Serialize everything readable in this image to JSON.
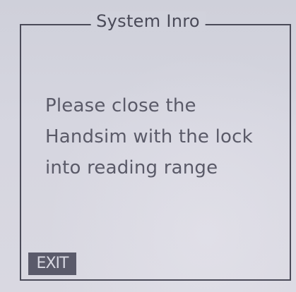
{
  "dialog": {
    "title": "System Inro",
    "message_lines": [
      "Please close the",
      "Handsim with the lock",
      "into reading range"
    ]
  },
  "softkeys": {
    "exit_label": "EXIT"
  }
}
